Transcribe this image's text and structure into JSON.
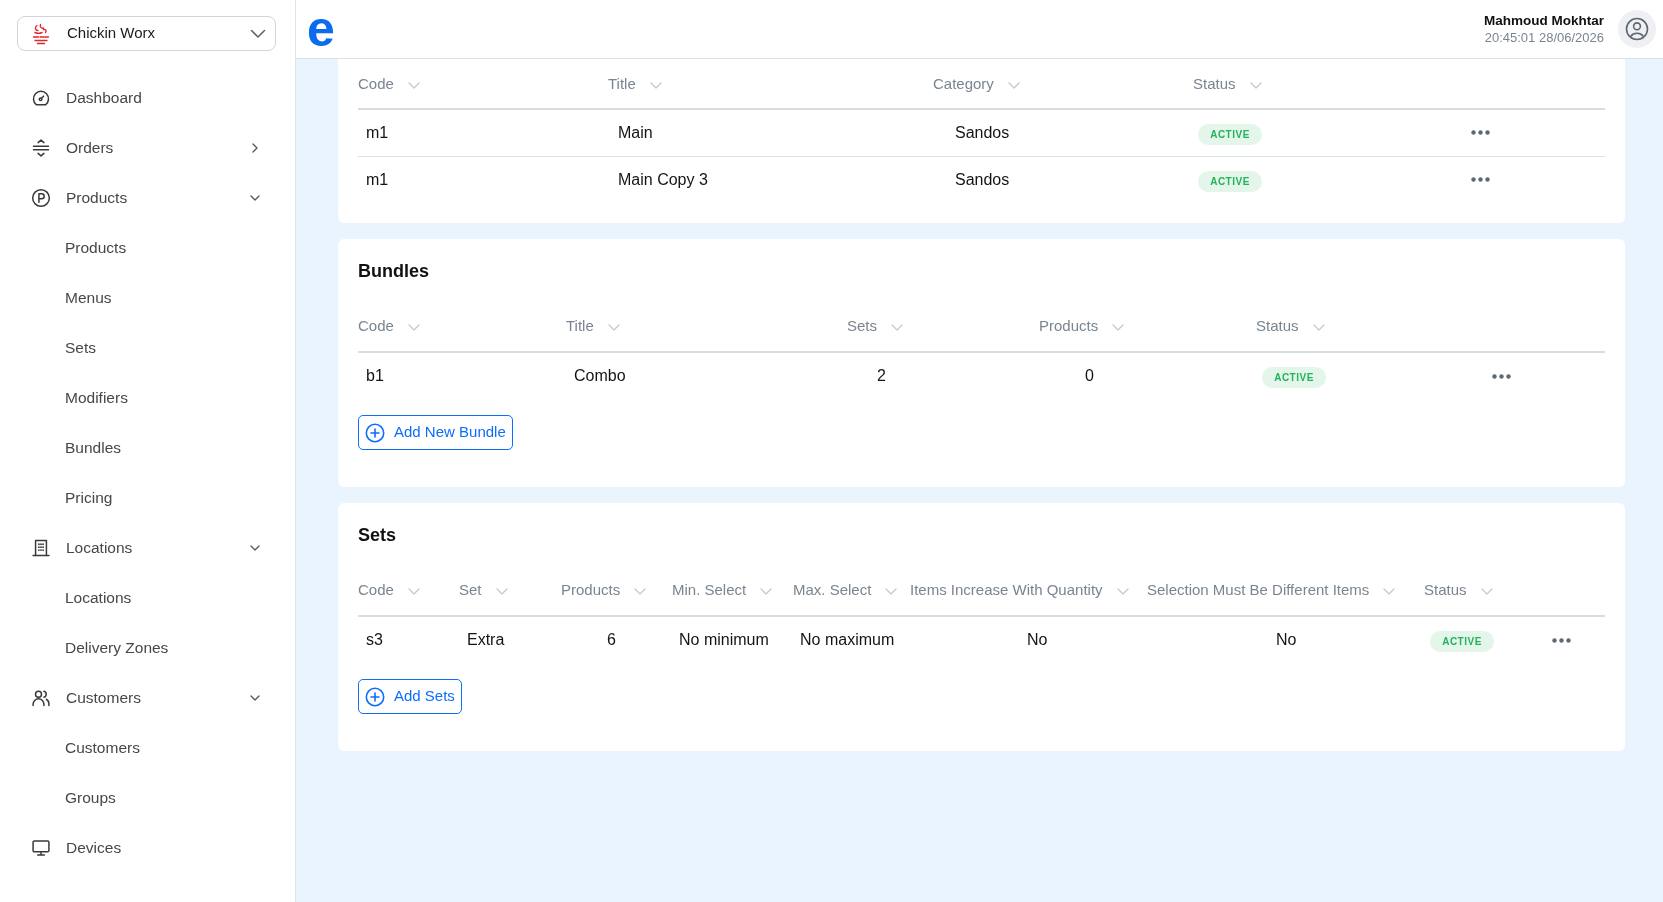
{
  "sidebar": {
    "brand": {
      "name": "Chickin Worx"
    },
    "items": [
      {
        "label": "Dashboard"
      },
      {
        "label": "Orders",
        "expanded": false
      },
      {
        "label": "Products",
        "expanded": true,
        "children": [
          {
            "label": "Products"
          },
          {
            "label": "Menus"
          },
          {
            "label": "Sets"
          },
          {
            "label": "Modifiers"
          },
          {
            "label": "Bundles"
          },
          {
            "label": "Pricing"
          }
        ]
      },
      {
        "label": "Locations",
        "expanded": true,
        "children": [
          {
            "label": "Locations"
          },
          {
            "label": "Delivery Zones"
          }
        ]
      },
      {
        "label": "Customers",
        "expanded": true,
        "children": [
          {
            "label": "Customers"
          },
          {
            "label": "Groups"
          }
        ]
      },
      {
        "label": "Devices"
      }
    ]
  },
  "header": {
    "logo": "e",
    "user": {
      "name": "Mahmoud Mokhtar",
      "datetime": "20:45:01 28/06/2026"
    }
  },
  "sections": [
    {
      "columns": [
        "Code",
        "Title",
        "Category",
        "Status"
      ],
      "rows": [
        {
          "cells": [
            "m1",
            "Main",
            "Sandos"
          ],
          "status": "ACTIVE"
        },
        {
          "cells": [
            "m1",
            "Main Copy 3",
            "Sandos"
          ],
          "status": "ACTIVE"
        }
      ]
    },
    {
      "title": "Bundles",
      "columns": [
        "Code",
        "Title",
        "Sets",
        "Products",
        "Status"
      ],
      "rows": [
        {
          "cells": [
            "b1",
            "Combo",
            "2",
            "0"
          ],
          "status": "ACTIVE"
        }
      ],
      "add_button": "Add New Bundle"
    },
    {
      "title": "Sets",
      "columns": [
        "Code",
        "Set",
        "Products",
        "Min. Select",
        "Max. Select",
        "Items Increase With Quantity",
        "Selection Must Be Different Items",
        "Status"
      ],
      "rows": [
        {
          "cells": [
            "s3",
            "Extra",
            "6",
            "No minimum",
            "No maximum",
            "No",
            "No"
          ],
          "status": "ACTIVE"
        }
      ],
      "add_button": "Add Sets"
    }
  ]
}
